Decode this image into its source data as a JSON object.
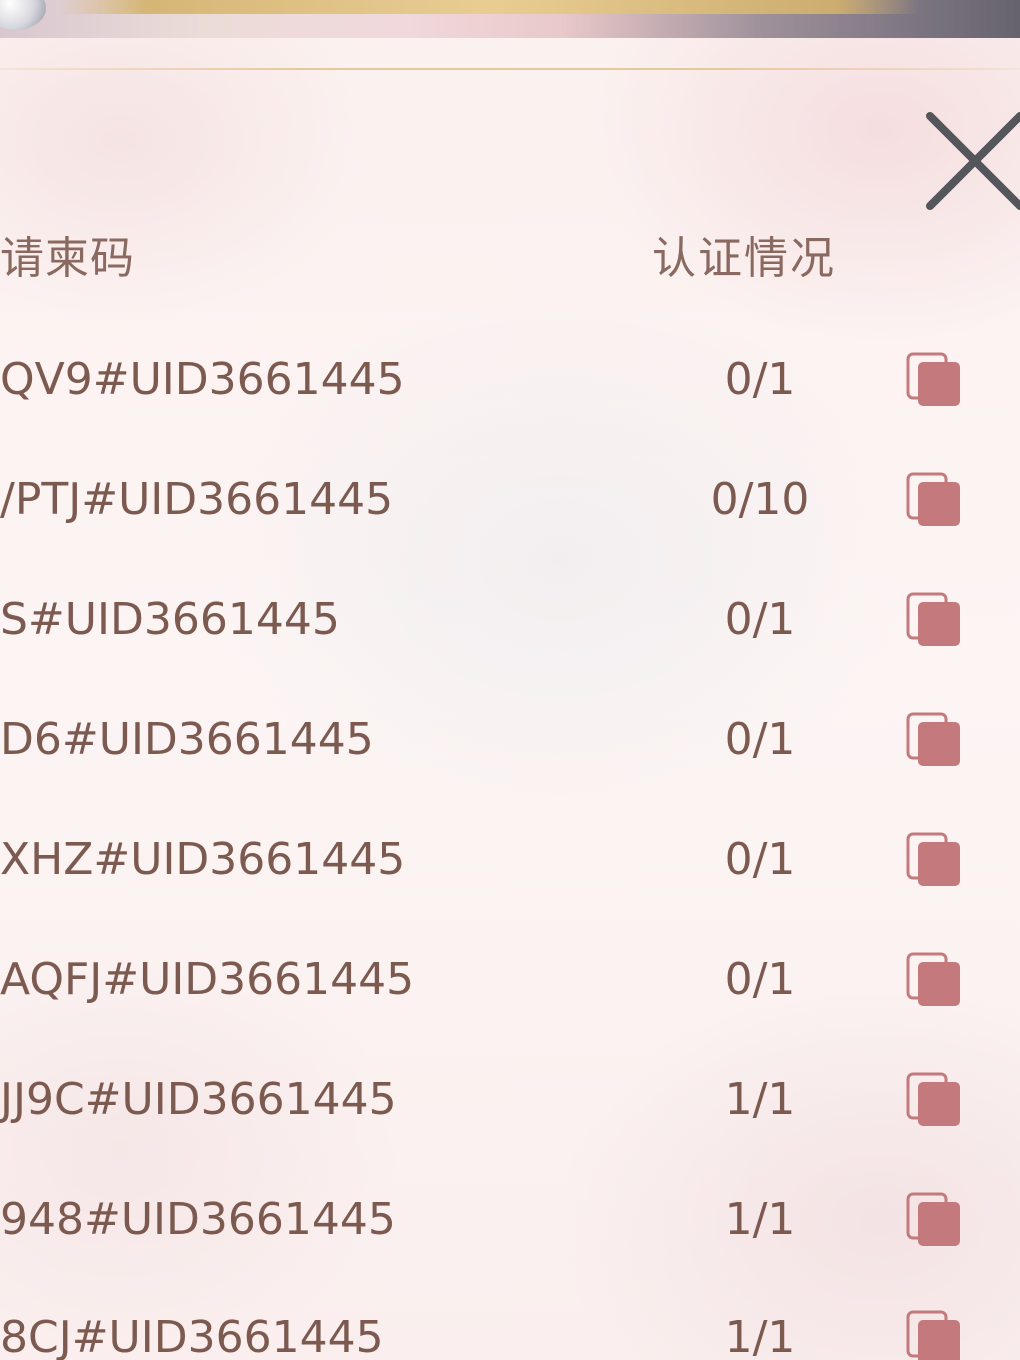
{
  "header": {
    "code_label": "请柬码",
    "status_label": "认证情况"
  },
  "rows": [
    {
      "code": "QV9#UID3661445",
      "status": "0/1"
    },
    {
      "code": "/PTJ#UID3661445",
      "status": "0/10"
    },
    {
      "code": "S#UID3661445",
      "status": "0/1"
    },
    {
      "code": "D6#UID3661445",
      "status": "0/1"
    },
    {
      "code": "XHZ#UID3661445",
      "status": "0/1"
    },
    {
      "code": "AQFJ#UID3661445",
      "status": "0/1"
    },
    {
      "code": "JJ9C#UID3661445",
      "status": "1/1"
    },
    {
      "code": "948#UID3661445",
      "status": "1/1"
    },
    {
      "code": "8CJ#UID3661445",
      "status": "1/1"
    }
  ],
  "icons": {
    "close": "close-icon",
    "copy": "copy-icon"
  },
  "colors": {
    "text": "#7c5a50",
    "copy_icon": "#c47a7c",
    "close_icon": "#55555c",
    "accent_gold": "#d4b26c"
  }
}
